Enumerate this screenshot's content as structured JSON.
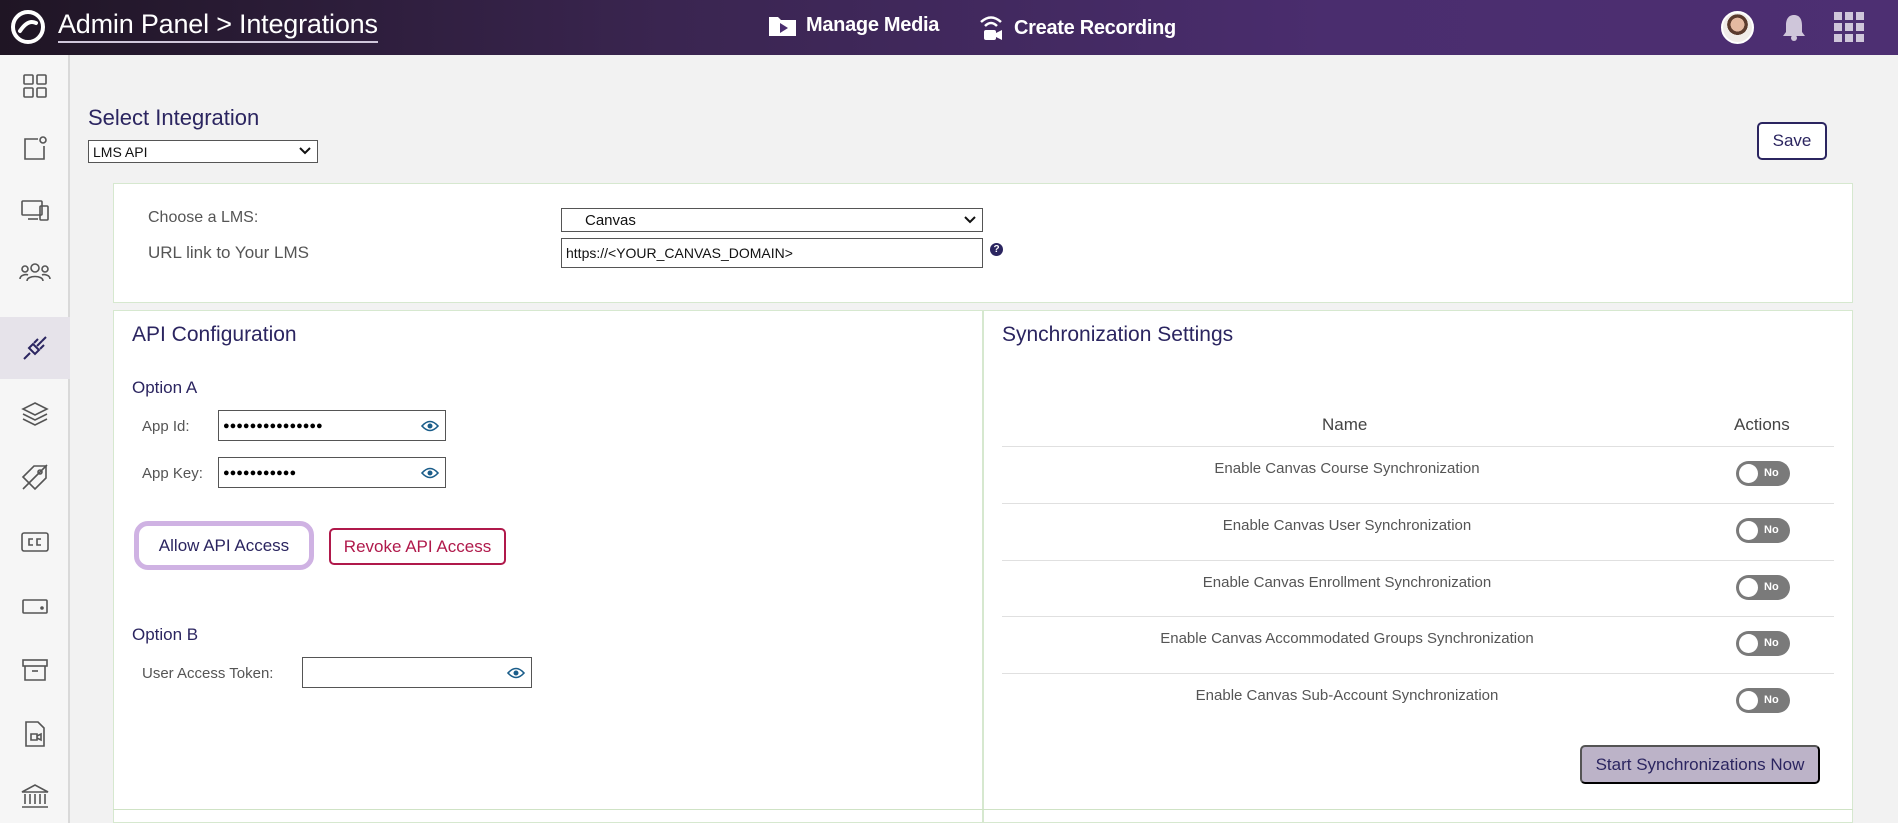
{
  "header": {
    "title": "Admin Panel > Integrations",
    "actions": [
      {
        "label": "Manage Media",
        "icon": "media-folder-icon"
      },
      {
        "label": "Create Recording",
        "icon": "recording-camera-icon"
      }
    ],
    "icons": [
      "avatar",
      "bell-icon",
      "apps-grid-icon"
    ]
  },
  "sidebar": {
    "items": [
      {
        "icon": "dashboard-grid-icon"
      },
      {
        "icon": "content-icon"
      },
      {
        "icon": "devices-icon"
      },
      {
        "icon": "users-icon"
      },
      {
        "icon": "integrations-plug-icon",
        "active": true
      },
      {
        "icon": "layers-icon"
      },
      {
        "icon": "tag-icon"
      },
      {
        "icon": "captions-cc-icon"
      },
      {
        "icon": "storage-icon"
      },
      {
        "icon": "archive-icon"
      },
      {
        "icon": "media-file-icon"
      },
      {
        "icon": "institution-icon"
      }
    ]
  },
  "integration": {
    "label": "Select Integration",
    "selected": "LMS API",
    "save_label": "Save"
  },
  "lms": {
    "choose_label": "Choose a LMS:",
    "choose_value": "Canvas",
    "url_label": "URL link to Your LMS",
    "url_value": "https://<YOUR_CANVAS_DOMAIN>",
    "help_glyph": "?"
  },
  "api": {
    "title": "API Configuration",
    "option_a": "Option A",
    "app_id_label": "App Id:",
    "app_id_value": "●●●●●●●●●●●●●●●",
    "app_key_label": "App Key:",
    "app_key_value": "●●●●●●●●●●●",
    "allow_label": "Allow API Access",
    "revoke_label": "Revoke API Access",
    "option_b": "Option B",
    "token_label": "User Access Token:",
    "token_value": ""
  },
  "sync": {
    "title": "Synchronization Settings",
    "col_name": "Name",
    "col_actions": "Actions",
    "rows": [
      {
        "name": "Enable Canvas Course Synchronization",
        "state": "No"
      },
      {
        "name": "Enable Canvas User Synchronization",
        "state": "No"
      },
      {
        "name": "Enable Canvas Enrollment Synchronization",
        "state": "No"
      },
      {
        "name": "Enable Canvas Accommodated Groups Synchronization",
        "state": "No"
      },
      {
        "name": "Enable Canvas Sub-Account Synchronization",
        "state": "No"
      }
    ],
    "start_label": "Start Synchronizations Now"
  }
}
